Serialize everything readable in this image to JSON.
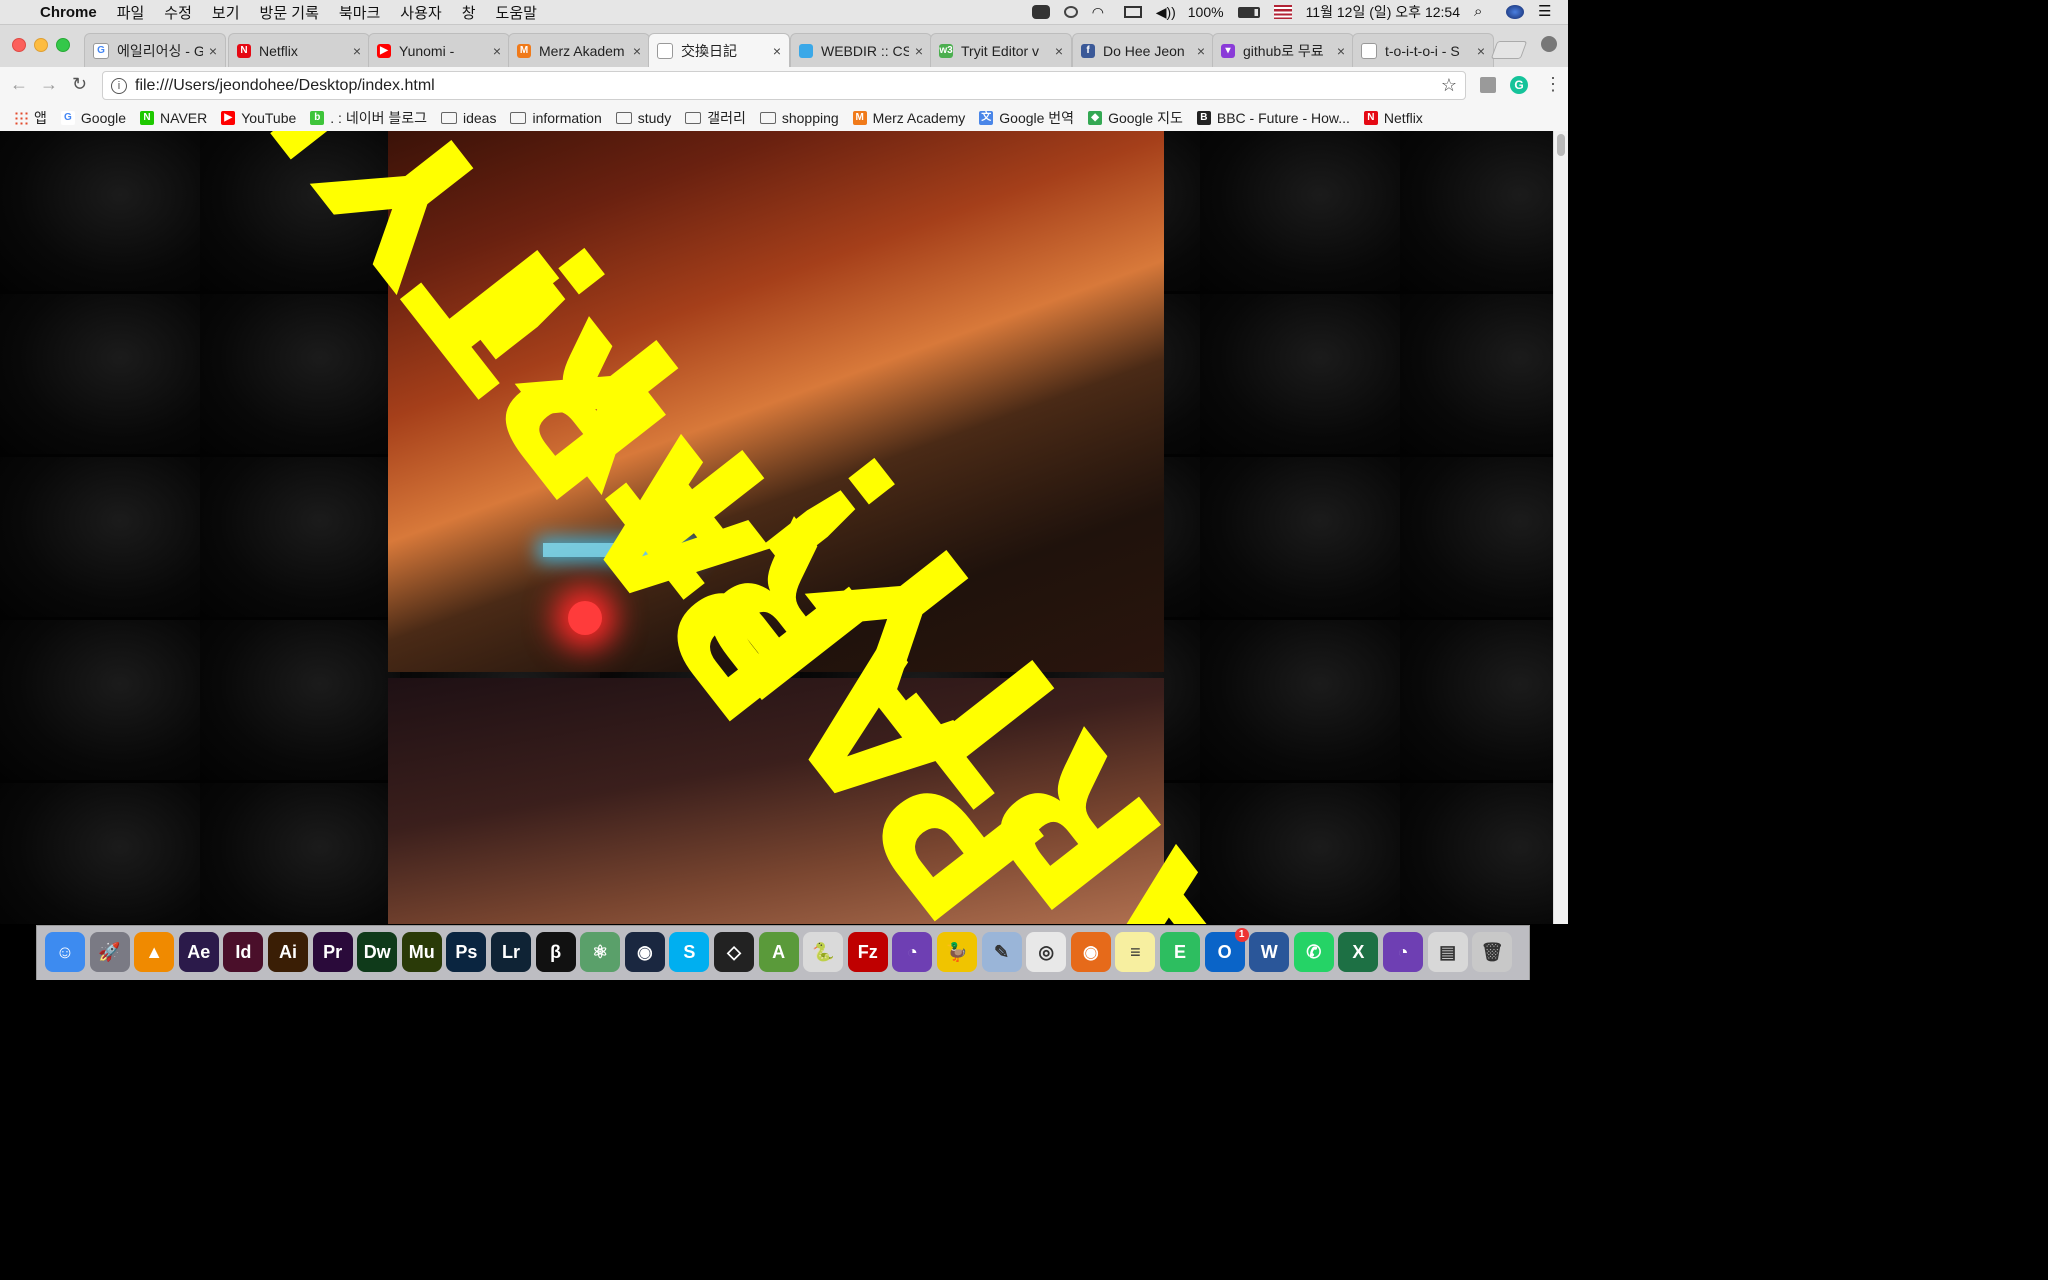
{
  "menubar": {
    "app_name": "Chrome",
    "items": [
      "파일",
      "수정",
      "보기",
      "방문 기록",
      "북마크",
      "사용자",
      "창",
      "도움말"
    ],
    "battery": "100%",
    "datetime": "11월 12일 (일) 오후 12:54"
  },
  "tabs": [
    {
      "title": "에일리어싱 - G",
      "icon": "google-icon",
      "color": "#ffffff",
      "glyph": "G"
    },
    {
      "title": "Netflix",
      "icon": "netflix-icon",
      "color": "#e50914",
      "glyph": "N"
    },
    {
      "title": "Yunomi - ",
      "icon": "youtube-icon",
      "color": "#ff0000",
      "glyph": "▶"
    },
    {
      "title": "Merz Akadem",
      "icon": "merz-icon",
      "color": "#f07a1a",
      "glyph": "M"
    },
    {
      "title": "交換日記",
      "icon": "file-icon",
      "color": "#ffffff",
      "glyph": ""
    },
    {
      "title": "WEBDIR :: CS",
      "icon": "webdir-icon",
      "color": "#3aa8e8",
      "glyph": ""
    },
    {
      "title": "Tryit Editor v",
      "icon": "w3-icon",
      "color": "#4caf50",
      "glyph": "w3"
    },
    {
      "title": "Do Hee Jeon",
      "icon": "facebook-icon",
      "color": "#3b5998",
      "glyph": "f"
    },
    {
      "title": "github로 무료",
      "icon": "github-tab-icon",
      "color": "#8a3bd8",
      "glyph": "▾"
    },
    {
      "title": "t-o-i-t-o-i - S",
      "icon": "file-icon",
      "color": "#ffffff",
      "glyph": ""
    }
  ],
  "active_tab_index": 4,
  "address": {
    "url": "file:///Users/jeondohee/Desktop/index.html"
  },
  "bookmarks": [
    {
      "label": "앱",
      "icon": "apps-grid-icon",
      "color": "#e34b2c",
      "glyph": ""
    },
    {
      "label": "Google",
      "icon": "google-icon",
      "color": "#ffffff",
      "glyph": "G"
    },
    {
      "label": "NAVER",
      "icon": "naver-icon",
      "color": "#1ec800",
      "glyph": "N"
    },
    {
      "label": "YouTube",
      "icon": "youtube-icon",
      "color": "#ff0000",
      "glyph": "▶"
    },
    {
      "label": ". : 네이버 블로그",
      "icon": "naver-blog-icon",
      "color": "#3ec43a",
      "glyph": "b"
    },
    {
      "label": "ideas",
      "icon": "folder-icon",
      "color": "",
      "glyph": ""
    },
    {
      "label": "information",
      "icon": "folder-icon",
      "color": "",
      "glyph": ""
    },
    {
      "label": "study",
      "icon": "folder-icon",
      "color": "",
      "glyph": ""
    },
    {
      "label": "갤러리",
      "icon": "folder-icon",
      "color": "",
      "glyph": ""
    },
    {
      "label": "shopping",
      "icon": "folder-icon",
      "color": "",
      "glyph": ""
    },
    {
      "label": "Merz Academy",
      "icon": "merz-icon",
      "color": "#f07a1a",
      "glyph": "M"
    },
    {
      "label": "Google 번역",
      "icon": "google-translate-icon",
      "color": "#4a86e8",
      "glyph": "文"
    },
    {
      "label": "Google 지도",
      "icon": "google-maps-icon",
      "color": "#34a853",
      "glyph": "◆"
    },
    {
      "label": "BBC - Future - How...",
      "icon": "bbc-icon",
      "color": "#222222",
      "glyph": "B"
    },
    {
      "label": "Netflix",
      "icon": "netflix-icon",
      "color": "#e50914",
      "glyph": "N"
    }
  ],
  "content": {
    "party_text": "PARTY!",
    "accent_color": "#ffff00"
  },
  "dock": [
    {
      "name": "finder-icon",
      "color": "#3d8bf0",
      "glyph": "☺"
    },
    {
      "name": "launchpad-icon",
      "color": "#7a7a84",
      "glyph": "🚀"
    },
    {
      "name": "vlc-icon",
      "color": "#f08a00",
      "glyph": "▲"
    },
    {
      "name": "after-effects-icon",
      "color": "#2b1a4a",
      "glyph": "Ae"
    },
    {
      "name": "indesign-icon",
      "color": "#4a0f2a",
      "glyph": "Id"
    },
    {
      "name": "illustrator-icon",
      "color": "#3a1e05",
      "glyph": "Ai"
    },
    {
      "name": "premiere-icon",
      "color": "#2a0a3a",
      "glyph": "Pr"
    },
    {
      "name": "dreamweaver-icon",
      "color": "#0f3a1a",
      "glyph": "Dw"
    },
    {
      "name": "muse-icon",
      "color": "#2a3a08",
      "glyph": "Mu"
    },
    {
      "name": "photoshop-icon",
      "color": "#0a2540",
      "glyph": "Ps"
    },
    {
      "name": "lightroom-icon",
      "color": "#0f2335",
      "glyph": "Lr"
    },
    {
      "name": "p5-icon",
      "color": "#111111",
      "glyph": "β"
    },
    {
      "name": "atom-icon",
      "color": "#5aa06a",
      "glyph": "⚛"
    },
    {
      "name": "cinema4d-icon",
      "color": "#1a2740",
      "glyph": "◉"
    },
    {
      "name": "skype-icon",
      "color": "#00aff0",
      "glyph": "S"
    },
    {
      "name": "unity-icon",
      "color": "#222222",
      "glyph": "◇"
    },
    {
      "name": "android-studio-icon",
      "color": "#5a9a3a",
      "glyph": "A"
    },
    {
      "name": "python-launcher-icon",
      "color": "#dadada",
      "glyph": "🐍"
    },
    {
      "name": "filezilla-icon",
      "color": "#bf0000",
      "glyph": "Fz"
    },
    {
      "name": "github-desktop-icon",
      "color": "#6e3fb3",
      "glyph": "◔"
    },
    {
      "name": "cyberduck-icon",
      "color": "#f0c400",
      "glyph": "🦆"
    },
    {
      "name": "preview-icon",
      "color": "#9ab5d8",
      "glyph": "✎"
    },
    {
      "name": "chrome-icon",
      "color": "#e8e8e8",
      "glyph": "◎"
    },
    {
      "name": "firefox-icon",
      "color": "#e66a1a",
      "glyph": "◉"
    },
    {
      "name": "notes-icon",
      "color": "#f7efa0",
      "glyph": "≡"
    },
    {
      "name": "evernote-icon",
      "color": "#2dbe60",
      "glyph": "E"
    },
    {
      "name": "outlook-icon",
      "color": "#0a64c8",
      "glyph": "O"
    },
    {
      "name": "word-icon",
      "color": "#2a5699",
      "glyph": "W"
    },
    {
      "name": "whatsapp-icon",
      "color": "#25d366",
      "glyph": "✆"
    },
    {
      "name": "excel-icon",
      "color": "#1d7044",
      "glyph": "X"
    },
    {
      "name": "github-icon",
      "color": "#6e3fb3",
      "glyph": "◔"
    },
    {
      "name": "excel-doc-icon",
      "color": "#d8d8d8",
      "glyph": "▤"
    },
    {
      "name": "trash-icon",
      "color": "#c8c8c8",
      "glyph": "🗑"
    }
  ],
  "outlook_badge": "1"
}
